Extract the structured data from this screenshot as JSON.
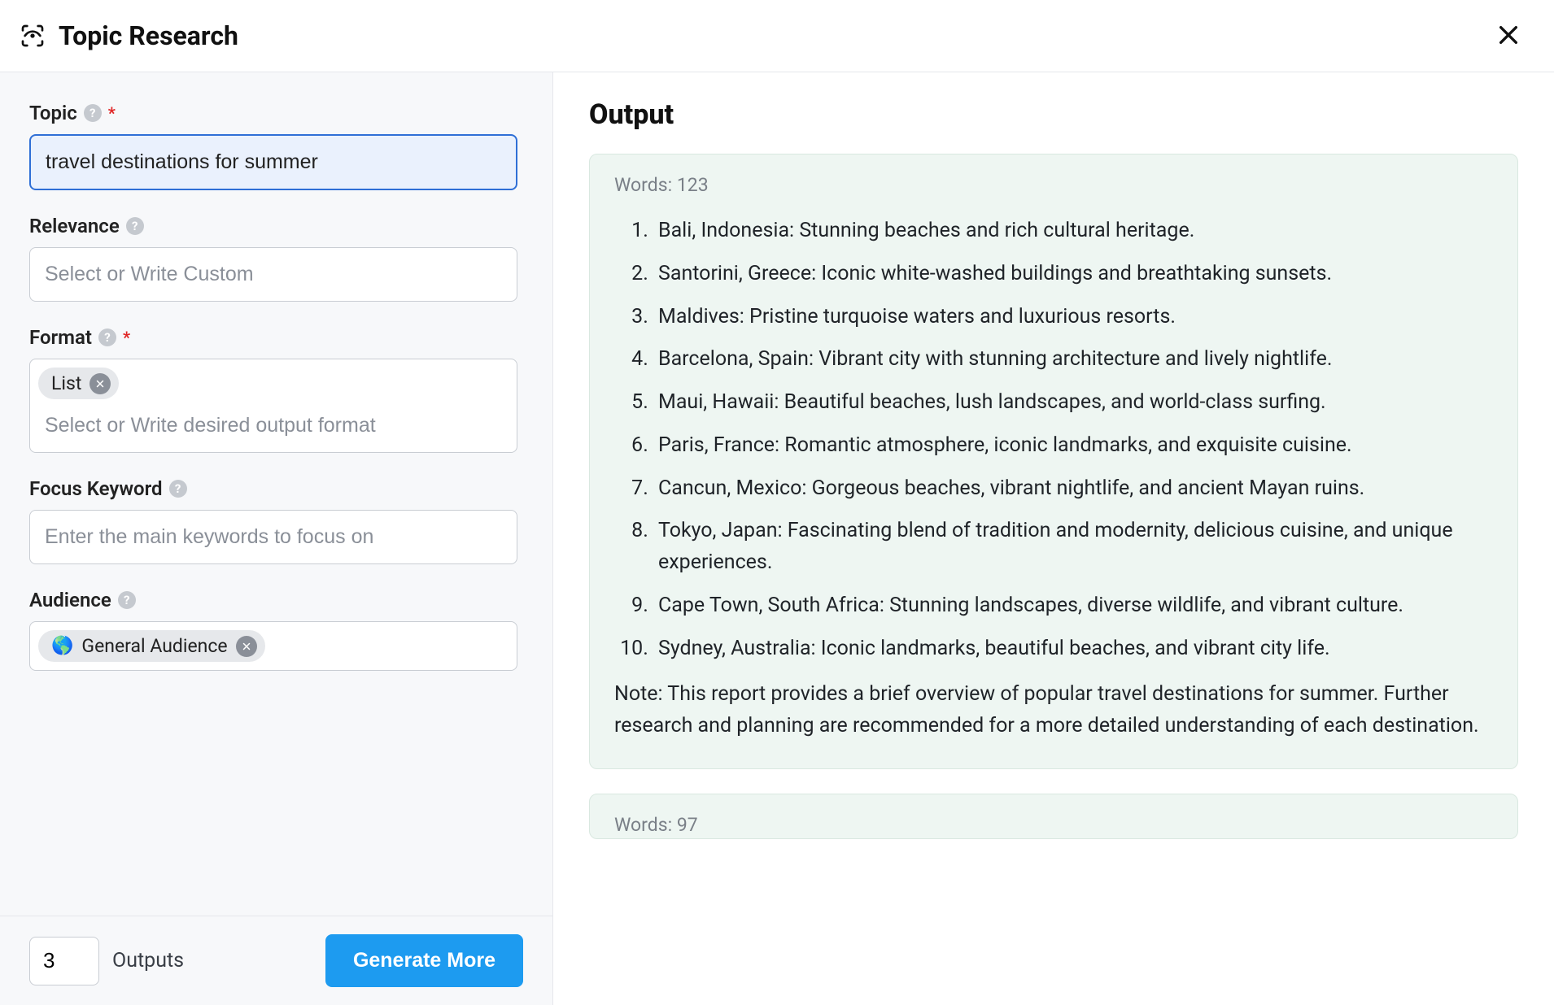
{
  "header": {
    "title": "Topic Research"
  },
  "form": {
    "topic": {
      "label": "Topic",
      "required": true,
      "value": "travel destinations for summer"
    },
    "relevance": {
      "label": "Relevance",
      "placeholder": "Select or Write Custom"
    },
    "format": {
      "label": "Format",
      "required": true,
      "tags": [
        "List"
      ],
      "placeholder": "Select or Write desired output format"
    },
    "focus_keyword": {
      "label": "Focus Keyword",
      "placeholder": "Enter the main keywords to focus on"
    },
    "audience": {
      "label": "Audience",
      "tags": [
        {
          "emoji": "🌎",
          "text": "General Audience"
        }
      ]
    }
  },
  "footer": {
    "outputs_count": "3",
    "outputs_label": "Outputs",
    "generate_label": "Generate More"
  },
  "output": {
    "title": "Output",
    "cards": [
      {
        "word_count": "Words: 123",
        "items": [
          "Bali, Indonesia: Stunning beaches and rich cultural heritage.",
          "Santorini, Greece: Iconic white-washed buildings and breathtaking sunsets.",
          "Maldives: Pristine turquoise waters and luxurious resorts.",
          "Barcelona, Spain: Vibrant city with stunning architecture and lively nightlife.",
          "Maui, Hawaii: Beautiful beaches, lush landscapes, and world-class surfing.",
          "Paris, France: Romantic atmosphere, iconic landmarks, and exquisite cuisine.",
          "Cancun, Mexico: Gorgeous beaches, vibrant nightlife, and ancient Mayan ruins.",
          "Tokyo, Japan: Fascinating blend of tradition and modernity, delicious cuisine, and unique experiences.",
          "Cape Town, South Africa: Stunning landscapes, diverse wildlife, and vibrant culture.",
          "Sydney, Australia: Iconic landmarks, beautiful beaches, and vibrant city life."
        ],
        "note": "Note: This report provides a brief overview of popular travel destinations for summer. Further research and planning are recommended for a more detailed understanding of each destination."
      },
      {
        "word_count": "Words: 97"
      }
    ]
  }
}
